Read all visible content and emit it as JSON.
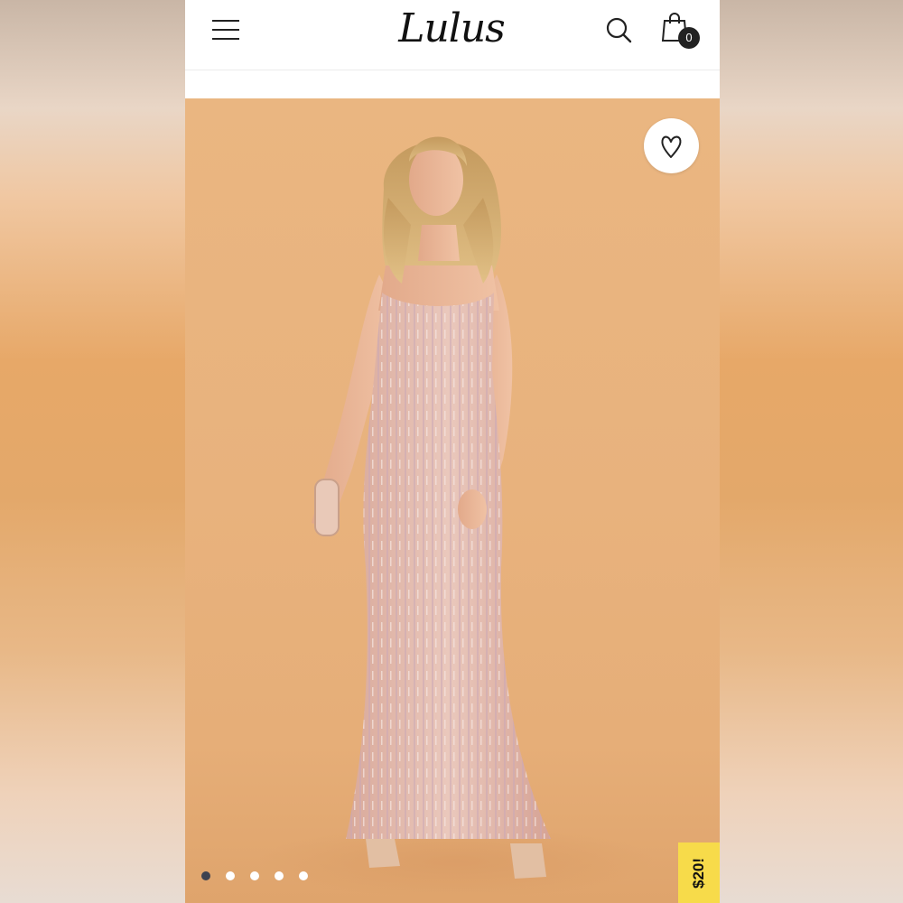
{
  "header": {
    "logo_text": "Lulus",
    "cart_count": "0"
  },
  "icons": {
    "menu": "hamburger-menu-icon",
    "search": "search-icon",
    "cart": "shopping-bag-icon",
    "wishlist": "heart-icon"
  },
  "gallery": {
    "image_count": 5,
    "active_index": 0
  },
  "promo": {
    "label": "$20!"
  },
  "colors": {
    "hero_background": "#e8b27d",
    "promo_background": "#f7db4a",
    "active_dot": "#3d4250"
  }
}
